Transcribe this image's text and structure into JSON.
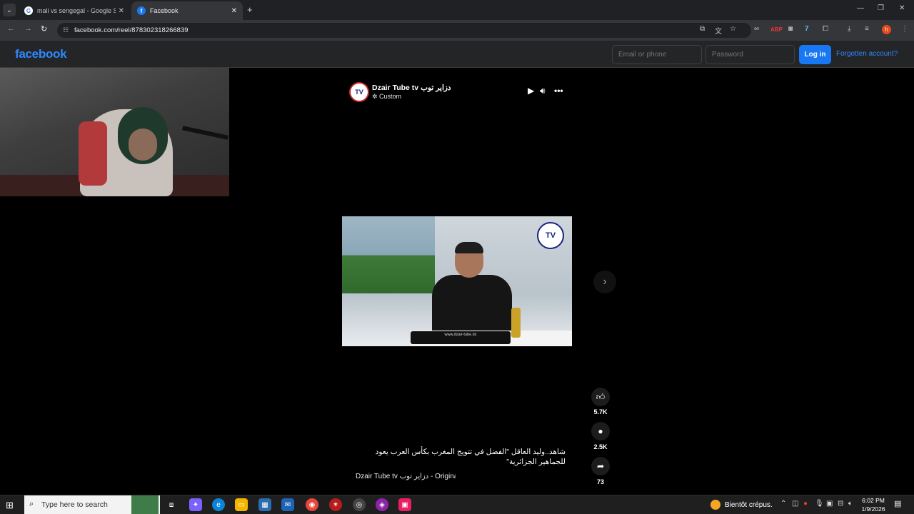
{
  "browser": {
    "tabs": [
      {
        "title": "mali vs sengegal - Google Search",
        "icon": "google-icon"
      },
      {
        "title": "Facebook",
        "icon": "facebook-icon"
      }
    ],
    "url": "facebook.com/reel/878302318266839"
  },
  "facebook": {
    "logo": "facebook",
    "email_placeholder": "Email or phone",
    "password_placeholder": "Password",
    "login_label": "Log in",
    "forgot_label": "Forgotten account?"
  },
  "reel": {
    "channel_name": "Dzair Tube tv دزاير توب",
    "channel_sub": "Custom",
    "video_bar_text": "www.dzair-tube.dz",
    "caption": "شاهد..وليد العاقل \"الفضل في تتويج المغرب بكأس العرب يعود للجماهير الجزائرية\"",
    "audio": "Dzair Tube tv دزاير توب - Original audio",
    "likes": "5.7K",
    "comments": "2.5K",
    "shares": "73"
  },
  "taskbar": {
    "search_placeholder": "Type here to search",
    "weather": "Bientôt crépus.",
    "time": "6:02 PM",
    "date": "1/9/2026"
  },
  "colors": {
    "facebook_blue": "#1877f2",
    "link_blue": "#2d88ff"
  }
}
